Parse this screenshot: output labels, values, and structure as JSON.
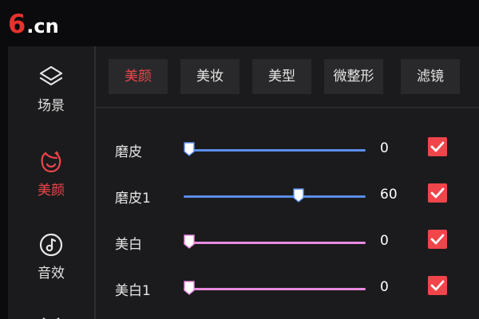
{
  "logo": {
    "six": "6",
    "dot_cn": ".cn"
  },
  "sidebar": {
    "items": [
      {
        "label": "场景",
        "icon": "layers-icon",
        "active": false
      },
      {
        "label": "美颜",
        "icon": "face-icon",
        "active": true
      },
      {
        "label": "音效",
        "icon": "music-disc-icon",
        "active": false
      }
    ]
  },
  "tabs": [
    {
      "label": "美颜",
      "active": true
    },
    {
      "label": "美妆",
      "active": false
    },
    {
      "label": "美型",
      "active": false
    },
    {
      "label": "微整形",
      "active": false
    },
    {
      "label": "滤镜",
      "active": false
    }
  ],
  "params": [
    {
      "label": "磨皮",
      "value": "0",
      "percent": 0,
      "checked": true,
      "color": "#5b8def"
    },
    {
      "label": "磨皮1",
      "value": "60",
      "percent": 60,
      "checked": true,
      "color": "#5b8def"
    },
    {
      "label": "美白",
      "value": "0",
      "percent": 0,
      "checked": true,
      "color": "#e98be0"
    },
    {
      "label": "美白1",
      "value": "0",
      "percent": 0,
      "checked": true,
      "color": "#e98be0"
    }
  ],
  "colors": {
    "accent": "#f0454a",
    "panel": "#1b1b1d",
    "background": "#0b0b0d"
  }
}
